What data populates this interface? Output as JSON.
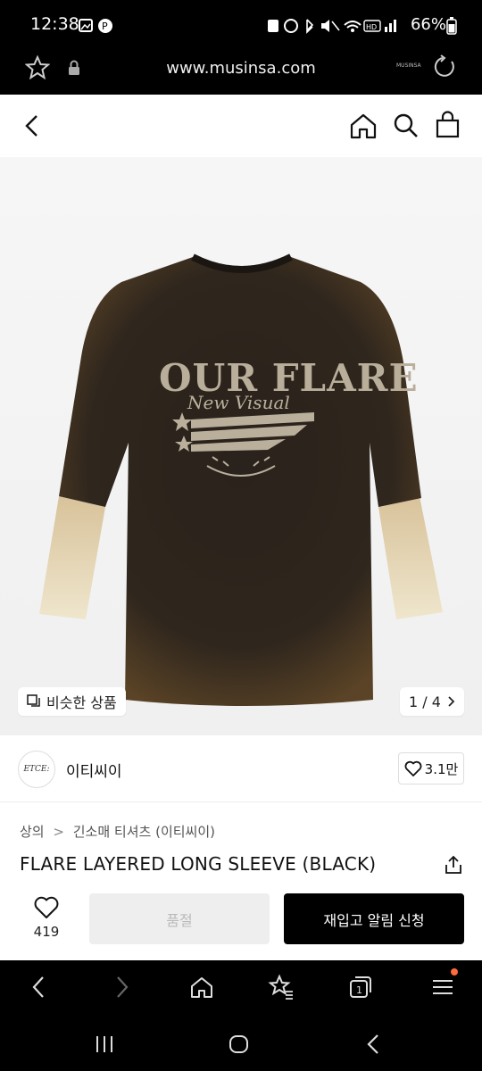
{
  "status": {
    "time": "12:38",
    "battery": "66%"
  },
  "browser": {
    "url": "www.musinsa.com",
    "menu_badge_color": "#ff6b3d"
  },
  "header": {
    "icons": [
      "back-icon",
      "home-icon",
      "search-icon",
      "cart-icon"
    ]
  },
  "gallery": {
    "similar_label": "비슷한 상품",
    "counter": "1 / 4"
  },
  "brand": {
    "logo_text": "ETCE:",
    "name": "이티씨이",
    "likes": "3.1만"
  },
  "product": {
    "breadcrumb": [
      "상의",
      "긴소매 티셔츠 (이티씨이)"
    ],
    "title": "FLARE LAYERED LONG SLEEVE (BLACK)"
  },
  "cta": {
    "like_count": "419",
    "soldout_label": "품절",
    "restock_label": "재입고 알림 신청"
  },
  "colors": {
    "primary": "#000000",
    "disabled_bg": "#eeeeee"
  }
}
